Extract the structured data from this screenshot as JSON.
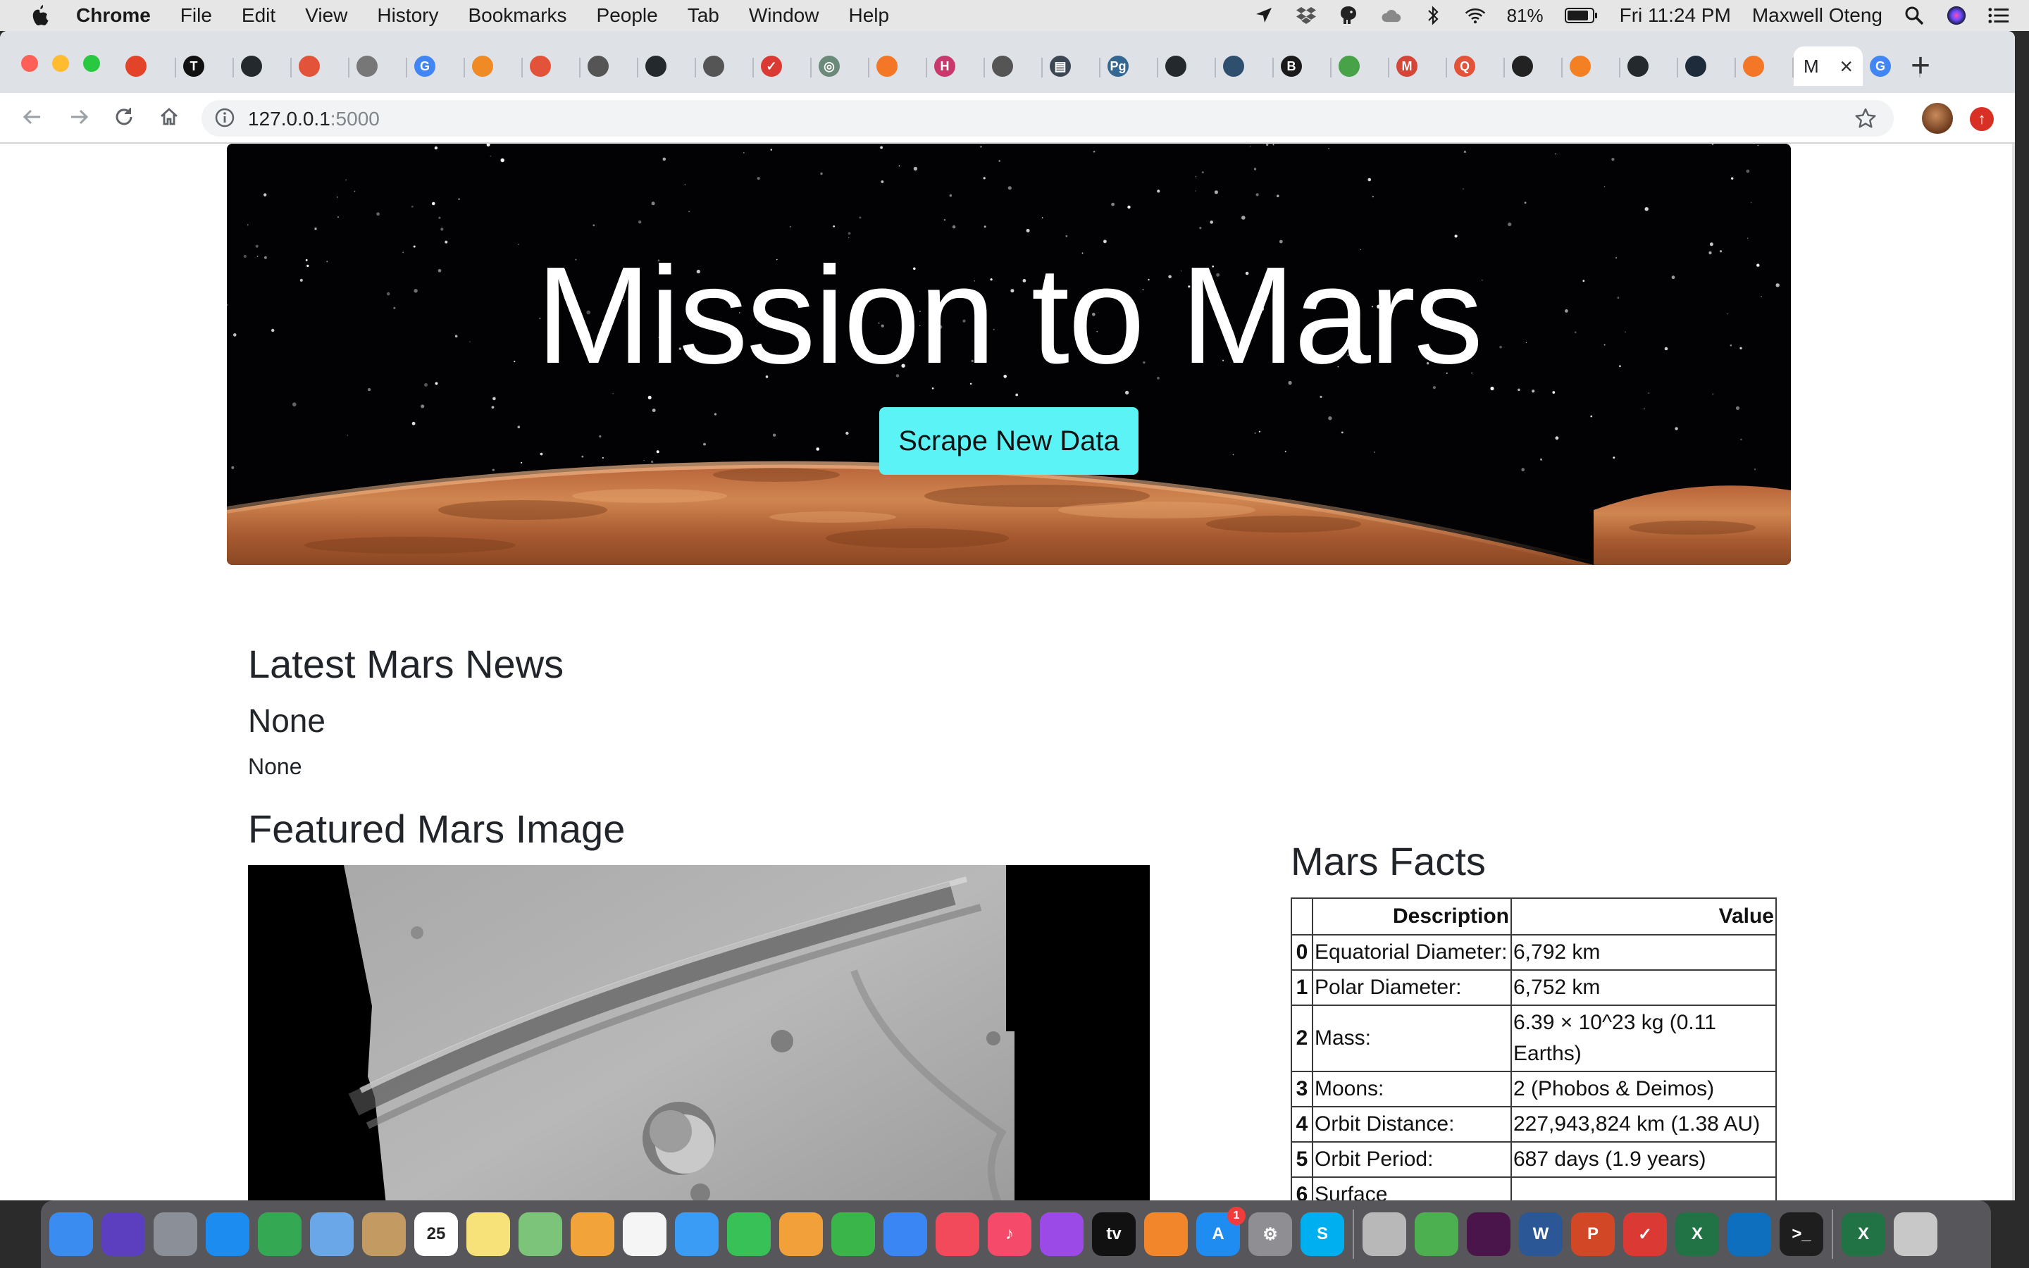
{
  "menubar": {
    "app_name": "Chrome",
    "menus": [
      "File",
      "Edit",
      "View",
      "History",
      "Bookmarks",
      "People",
      "Tab",
      "Window",
      "Help"
    ],
    "battery": "81%",
    "clock": "Fri 11:24 PM",
    "user": "Maxwell Oteng"
  },
  "browser": {
    "url_host": "127.0.0.1",
    "url_port": ":5000",
    "tabs": [
      {
        "icon": "gitlab-icon",
        "color": "#e24329",
        "glyph": ""
      },
      {
        "icon": "nytimes-icon",
        "color": "#111111",
        "glyph": "T"
      },
      {
        "icon": "github-icon",
        "color": "#24292e",
        "glyph": ""
      },
      {
        "icon": "helmet-icon",
        "color": "#e2533a",
        "glyph": ""
      },
      {
        "icon": "gear-icon",
        "color": "#777777",
        "glyph": ""
      },
      {
        "icon": "google-icon",
        "color": "#4285f4",
        "glyph": "G"
      },
      {
        "icon": "box-icon",
        "color": "#f08a24",
        "glyph": ""
      },
      {
        "icon": "helmet-icon",
        "color": "#e2533a",
        "glyph": ""
      },
      {
        "icon": "globe-icon",
        "color": "#555555",
        "glyph": ""
      },
      {
        "icon": "github-icon",
        "color": "#24292e",
        "glyph": ""
      },
      {
        "icon": "globe-icon",
        "color": "#555555",
        "glyph": ""
      },
      {
        "icon": "check-icon",
        "color": "#db3a34",
        "glyph": "✓"
      },
      {
        "icon": "target-icon",
        "color": "#6c8a7a",
        "glyph": "◎"
      },
      {
        "icon": "jupyter-icon",
        "color": "#f37726",
        "glyph": ""
      },
      {
        "icon": "h-icon",
        "color": "#c93a6c",
        "glyph": "H"
      },
      {
        "icon": "globe-icon",
        "color": "#555555",
        "glyph": ""
      },
      {
        "icon": "reader-icon",
        "color": "#3d4653",
        "glyph": "▤"
      },
      {
        "icon": "postgres-icon",
        "color": "#336791",
        "glyph": "Pg"
      },
      {
        "icon": "github-icon",
        "color": "#24292e",
        "glyph": ""
      },
      {
        "icon": "python-icon",
        "color": "#2f4f6f",
        "glyph": ""
      },
      {
        "icon": "bootstrap-icon",
        "color": "#1a1a1a",
        "glyph": "B"
      },
      {
        "icon": "mongodb-icon",
        "color": "#47a248",
        "glyph": ""
      },
      {
        "icon": "gmail-icon",
        "color": "#d44638",
        "glyph": "M"
      },
      {
        "icon": "quora-icon",
        "color": "#e2533a",
        "glyph": "Q"
      },
      {
        "icon": "arch-icon",
        "color": "#222222",
        "glyph": ""
      },
      {
        "icon": "stackoverflow-icon",
        "color": "#f48024",
        "glyph": ""
      },
      {
        "icon": "github-icon",
        "color": "#24292e",
        "glyph": ""
      },
      {
        "icon": "terminal-icon",
        "color": "#1d2b3a",
        "glyph": ""
      },
      {
        "icon": "jupyter-icon",
        "color": "#f37726",
        "glyph": ""
      }
    ],
    "active_tab_label": "M",
    "last_tab_icon": "google-icon"
  },
  "hero": {
    "title": "Mission to Mars",
    "button_label": "Scrape New Data"
  },
  "news": {
    "heading": "Latest Mars News",
    "title": "None",
    "paragraph": "None"
  },
  "featured": {
    "heading": "Featured Mars Image"
  },
  "facts": {
    "heading": "Mars Facts",
    "columns": [
      "",
      "Description",
      "Value"
    ],
    "rows": [
      {
        "index": "0",
        "description": "Equatorial Diameter:",
        "value": "6,792 km"
      },
      {
        "index": "1",
        "description": "Polar Diameter:",
        "value": "6,752 km"
      },
      {
        "index": "2",
        "description": "Mass:",
        "value": "6.39 × 10^23 kg (0.11 Earths)"
      },
      {
        "index": "3",
        "description": "Moons:",
        "value": "2 (Phobos & Deimos)"
      },
      {
        "index": "4",
        "description": "Orbit Distance:",
        "value": "227,943,824 km (1.38 AU)"
      },
      {
        "index": "5",
        "description": "Orbit Period:",
        "value": "687 days (1.9 years)"
      },
      {
        "index": "6",
        "description": "Surface",
        "value": ""
      }
    ]
  },
  "dock": {
    "calendar_day": "25",
    "appstore_badge": "1",
    "apps": [
      {
        "name": "finder-icon",
        "color": "#3b8cf0",
        "glyph": ""
      },
      {
        "name": "siri-icon",
        "color": "#5c3fbf",
        "glyph": ""
      },
      {
        "name": "launchpad-icon",
        "color": "#8a8f98",
        "glyph": ""
      },
      {
        "name": "safari-icon",
        "color": "#1d8cf0",
        "glyph": ""
      },
      {
        "name": "chrome-icon",
        "color": "#34a853",
        "glyph": ""
      },
      {
        "name": "mail-icon",
        "color": "#6aa7e8",
        "glyph": ""
      },
      {
        "name": "contacts-icon",
        "color": "#c29a62",
        "glyph": ""
      },
      {
        "name": "calendar-icon",
        "color": "#ffffff",
        "glyph": "25"
      },
      {
        "name": "notes-icon",
        "color": "#f7e27a",
        "glyph": ""
      },
      {
        "name": "maps-icon",
        "color": "#7cc47a",
        "glyph": ""
      },
      {
        "name": "photos-icon",
        "color": "#f2a33a",
        "glyph": ""
      },
      {
        "name": "reminders-icon",
        "color": "#f5f5f5",
        "glyph": ""
      },
      {
        "name": "messages-icon",
        "color": "#3a9cf5",
        "glyph": ""
      },
      {
        "name": "facetime-icon",
        "color": "#38c157",
        "glyph": ""
      },
      {
        "name": "pages-icon",
        "color": "#f2a03a",
        "glyph": ""
      },
      {
        "name": "numbers-icon",
        "color": "#3ab54a",
        "glyph": ""
      },
      {
        "name": "keynote-icon",
        "color": "#3a86f5",
        "glyph": ""
      },
      {
        "name": "news-icon",
        "color": "#f24a5a",
        "glyph": ""
      },
      {
        "name": "music-icon",
        "color": "#f54a6a",
        "glyph": "♪"
      },
      {
        "name": "podcasts-icon",
        "color": "#9b4ae8",
        "glyph": ""
      },
      {
        "name": "tv-icon",
        "color": "#111111",
        "glyph": "tv"
      },
      {
        "name": "books-icon",
        "color": "#f2862a",
        "glyph": ""
      },
      {
        "name": "appstore-icon",
        "color": "#1e8cf0",
        "glyph": "A"
      },
      {
        "name": "system-preferences-icon",
        "color": "#8e8e93",
        "glyph": "⚙"
      },
      {
        "name": "skype-icon",
        "color": "#00aff0",
        "glyph": "S"
      },
      {
        "name": "keychain-icon",
        "color": "#b8b8b8",
        "glyph": ""
      },
      {
        "name": "sync-icon",
        "color": "#4caf50",
        "glyph": ""
      },
      {
        "name": "slack-icon",
        "color": "#4a154b",
        "glyph": ""
      },
      {
        "name": "word-icon",
        "color": "#2b5797",
        "glyph": "W"
      },
      {
        "name": "powerpoint-icon",
        "color": "#d24726",
        "glyph": "P"
      },
      {
        "name": "todo-icon",
        "color": "#db3a34",
        "glyph": "✓"
      },
      {
        "name": "excel-icon",
        "color": "#217346",
        "glyph": "X"
      },
      {
        "name": "vscode-icon",
        "color": "#0e6fbf",
        "glyph": ""
      },
      {
        "name": "terminal-icon",
        "color": "#1e1e1e",
        "glyph": ">_"
      },
      {
        "name": "excel-document-icon",
        "color": "#217346",
        "glyph": "X"
      },
      {
        "name": "trash-icon",
        "color": "#c8c8c8",
        "glyph": ""
      }
    ]
  }
}
